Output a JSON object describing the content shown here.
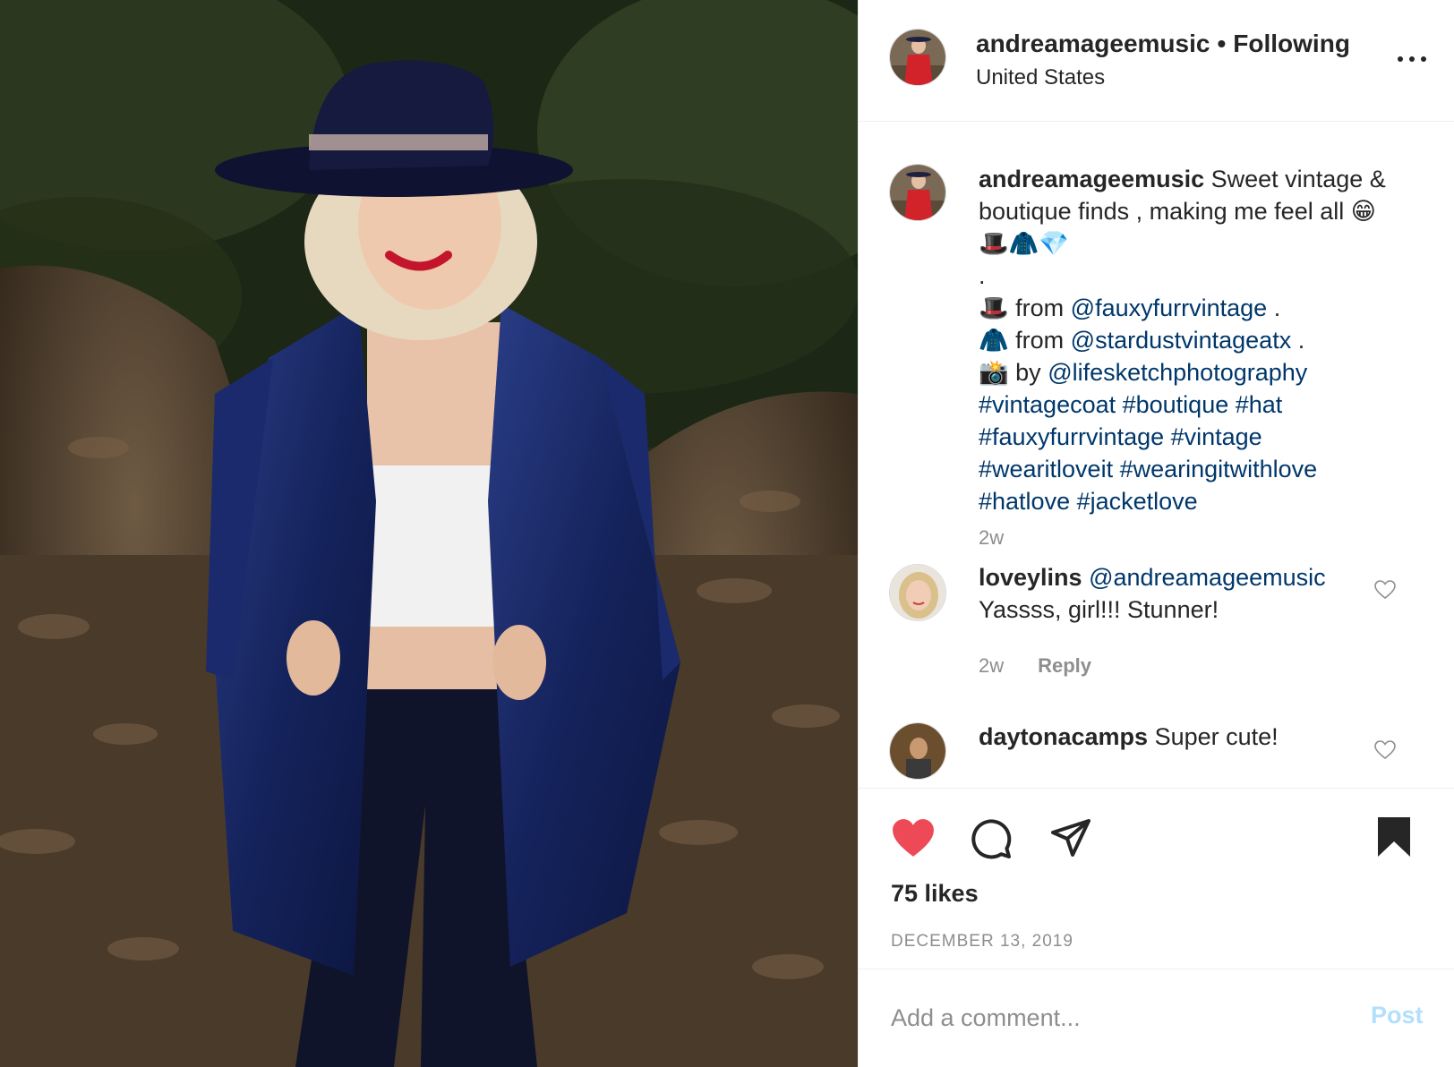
{
  "header": {
    "username": "andreamageemusic",
    "separator": "•",
    "follow_status": "Following",
    "location": "United States"
  },
  "caption": {
    "username": "andreamageemusic",
    "line1_text": "Sweet vintage &",
    "line2_text": "boutique finds , making me feel all 😁",
    "line3_text": "🎩🧥💎",
    "line4_text": ".",
    "hat_emoji": "🎩",
    "from_label_1": "from",
    "mention_1": "@fauxyfurrvintage",
    "mention_1_after": ".",
    "coat_emoji": "🧥",
    "from_label_2": "from",
    "mention_2": "@stardustvintageatx",
    "mention_2_after": ".",
    "camera_emoji": "📸",
    "by_label": "by",
    "mention_3": "@lifesketchphotography",
    "hashtags_line1": "#vintagecoat #boutique #hat",
    "hashtags_line2": "#fauxyfurrvintage #vintage",
    "hashtags_line3": "#wearitloveit #wearingitwithlove",
    "hashtags_line4": "#hatlove #jacketlove",
    "time": "2w"
  },
  "comments": [
    {
      "username": "loveylins",
      "mention": "@andreamageemusic",
      "text": "Yassss, girl!!! Stunner!",
      "time": "2w",
      "reply_label": "Reply"
    },
    {
      "username": "daytonacamps",
      "text": "Super cute!"
    }
  ],
  "actions": {
    "icons": [
      "heart-filled-icon",
      "comment-icon",
      "share-icon",
      "bookmark-filled-icon"
    ],
    "like_color": "#ed4956"
  },
  "likes": "75 likes",
  "date": "DECEMBER 13, 2019",
  "add_comment": {
    "placeholder": "Add a comment...",
    "post_label": "Post",
    "post_color": "#b2dffc"
  }
}
